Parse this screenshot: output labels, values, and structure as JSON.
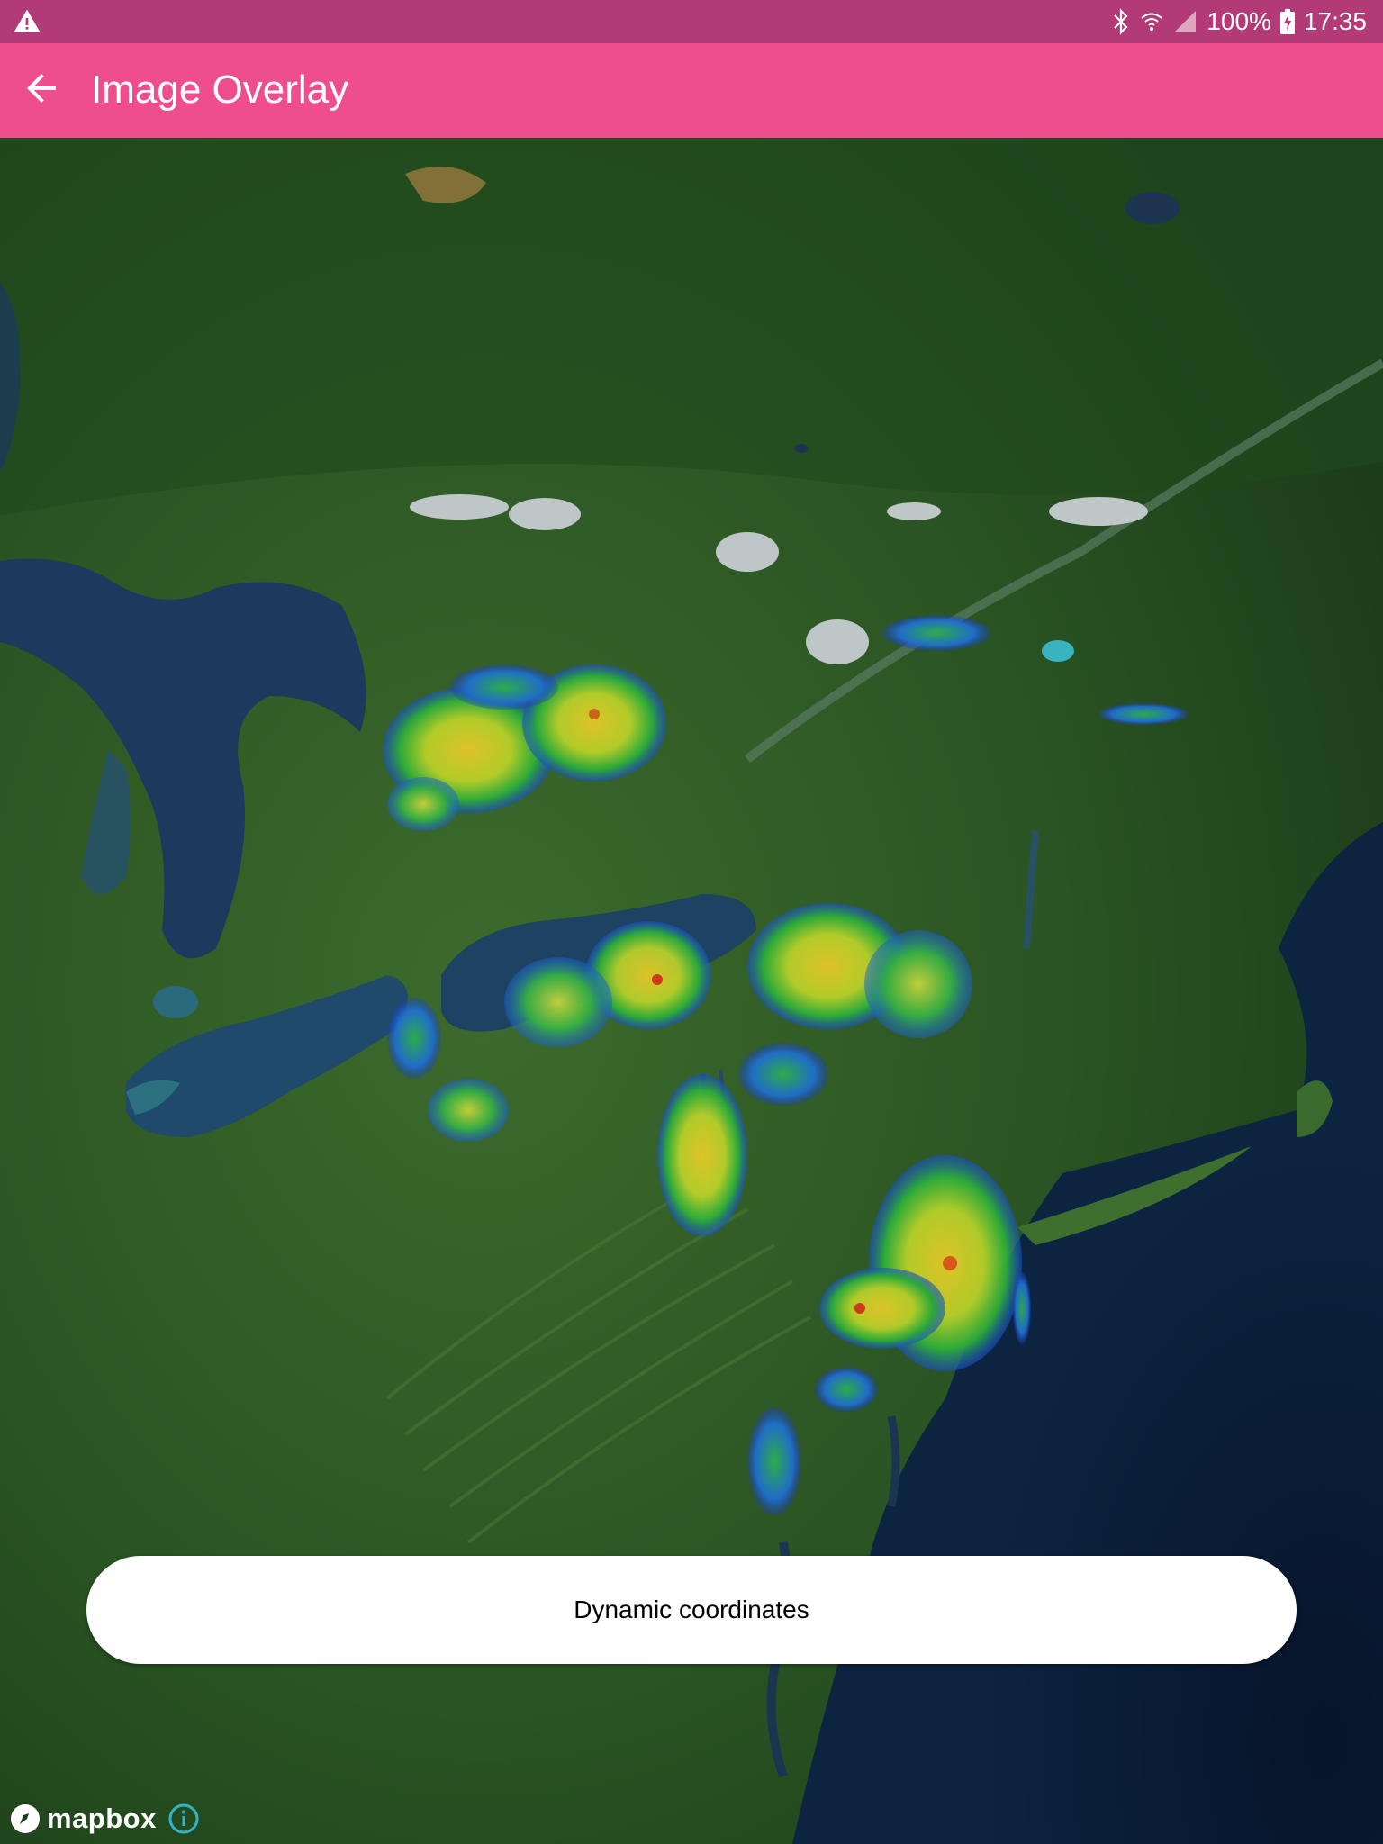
{
  "status_bar": {
    "battery": "100%",
    "time": "17:35",
    "icons": [
      "warning-icon",
      "bluetooth-icon",
      "wifi-icon",
      "cell-signal-icon",
      "battery-charging-icon"
    ]
  },
  "app_bar": {
    "title": "Image Overlay",
    "back_icon": "arrow-back-icon"
  },
  "map": {
    "attribution": "mapbox",
    "info_icon": "info-icon"
  },
  "action_button": {
    "label": "Dynamic coordinates"
  },
  "colors": {
    "status_bar": "#b23a77",
    "app_bar": "#ee4d8e",
    "button_bg": "#ffffff"
  }
}
